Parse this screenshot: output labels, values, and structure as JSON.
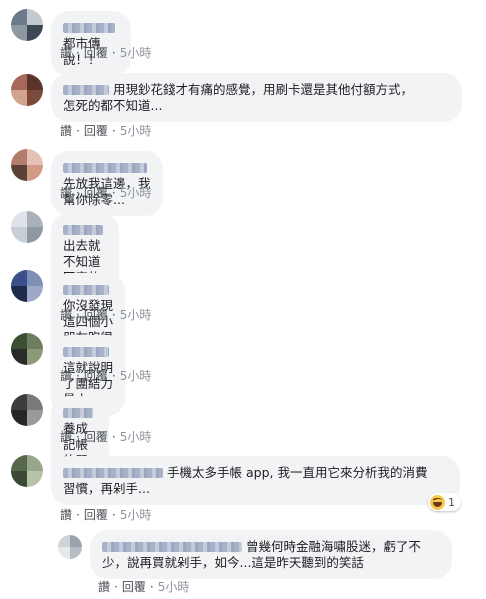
{
  "action_labels": {
    "like": "讚",
    "reply": "回覆",
    "separator": "·"
  },
  "colors": {
    "bubble": "#f2f3f5",
    "action_text": "#4b4f56",
    "time_text": "#90949c"
  },
  "comments": [
    {
      "text": "都市傳說！！",
      "time": "5小時",
      "avatar_colors": [
        "#6d7a8a",
        "#c4c9cf",
        "#8e98a3",
        "#3d4755"
      ]
    },
    {
      "text": "用現鈔花錢才有痛的感覺，用刷卡還是其他付額方式，\n怎死的都不知道...",
      "time": "5小時",
      "avatar_colors": [
        "#a5685a",
        "#5a3428",
        "#d2a38e",
        "#7b4a3a"
      ]
    },
    {
      "text": "先放我這邊，我幫你除零...",
      "time": "5小時",
      "avatar_colors": [
        "#b37c6d",
        "#e4c1b4",
        "#5a4037",
        "#d39a86"
      ]
    },
    {
      "text": "出去就不知道回家的孩子們",
      "time": "5小時",
      "avatar_colors": [
        "#dfe3e8",
        "#a9b2bb",
        "#c8ced6",
        "#8f99a3"
      ]
    },
    {
      "text": "你沒發現這四個小朋友跑很快嗎？",
      "time": "5小時",
      "avatar_colors": [
        "#3b4f8a",
        "#7d8fb5",
        "#1f2b4a",
        "#a0a8c8"
      ]
    },
    {
      "text": "這就說明了團結力量大",
      "time": "5小時",
      "avatar_colors": [
        "#3a4f33",
        "#6d7d5d",
        "#2a2a2a",
        "#8c9a7a"
      ]
    },
    {
      "text": "養成記帳的習慣",
      "time": "5小時",
      "avatar_colors": [
        "#3d3d3d",
        "#7a7a7a",
        "#262626",
        "#9a9a9a"
      ]
    },
    {
      "text": "手機太多手帳 app, 我一直用它來分析我的消費\n習慣，再剁手...",
      "time": "5小時",
      "avatar_colors": [
        "#566a4b",
        "#9aa68a",
        "#3b4a35",
        "#b8c2a7"
      ],
      "reaction": {
        "icon": "haha-icon",
        "count": "1"
      }
    },
    {
      "text": "曾幾何時金融海嘯股迷，虧了不\n少，說再買就剁手，如今...這是昨天聽到的笑話",
      "time": "5小時",
      "avatar_colors": [
        "#cfd4da",
        "#9aa3ad",
        "#e6e9ec",
        "#b5bcc4"
      ]
    }
  ]
}
